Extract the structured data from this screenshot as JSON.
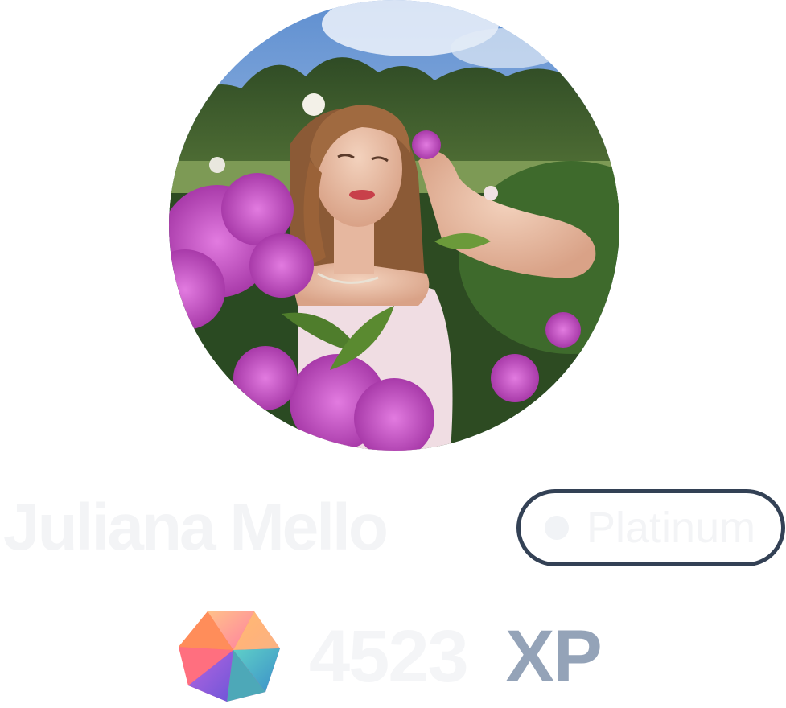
{
  "profile": {
    "name": "Juliana Mello",
    "tier": "Platinum",
    "xp_value": "4523",
    "xp_unit": "XP",
    "avatar_icon": "profile-photo-woman-flowers",
    "gem_icon": "iridescent-gem-icon"
  },
  "colors": {
    "badge_border": "#334155",
    "name_text": "#f3f4f6",
    "xp_unit_text": "#94a3b8",
    "flower_pink": "#c04cc6",
    "sky_blue": "#6f9fd8"
  }
}
